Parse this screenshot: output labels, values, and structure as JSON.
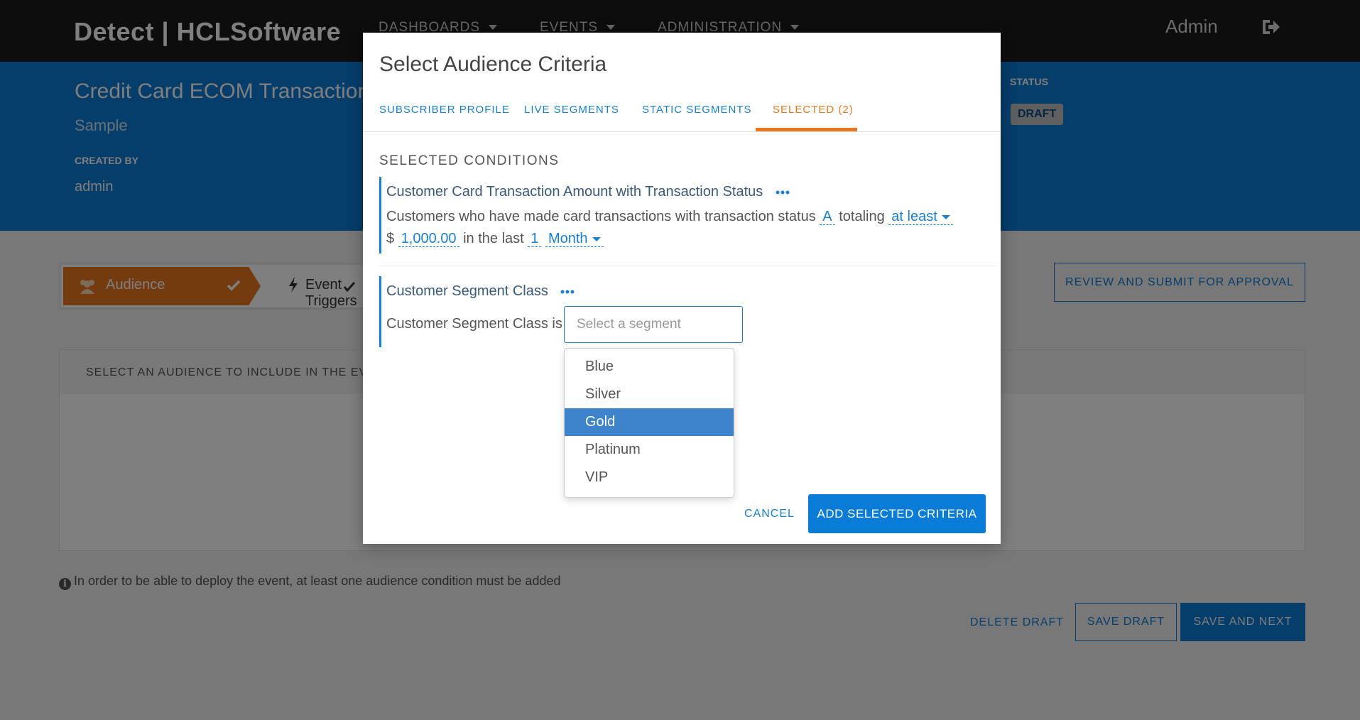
{
  "nav": {
    "logo": "Detect | HCLSoftware",
    "items": [
      "DASHBOARDS",
      "EVENTS",
      "ADMINISTRATION"
    ],
    "user": "Admin"
  },
  "header": {
    "title": "Credit Card ECOM Transaction",
    "subtitle": "Sample",
    "created_by_label": "CREATED BY",
    "created_by": "admin",
    "status_label": "STATUS",
    "status": "DRAFT"
  },
  "steps": {
    "audience": "Audience",
    "event_triggers": "Event Triggers"
  },
  "actions": {
    "review": "REVIEW AND SUBMIT FOR APPROVAL",
    "delete_draft": "DELETE DRAFT",
    "save_draft": "SAVE DRAFT",
    "save_next": "SAVE AND NEXT"
  },
  "panel": {
    "heading": "SELECT AN AUDIENCE TO INCLUDE IN THE EVE"
  },
  "info": "In order to be able to deploy the event, at least one audience condition must be added",
  "modal": {
    "title": "Select Audience Criteria",
    "tabs": [
      "SUBSCRIBER PROFILE",
      "LIVE SEGMENTS",
      "STATIC SEGMENTS",
      "SELECTED (2)"
    ],
    "active_tab": "SELECTED (2)",
    "selected_heading": "SELECTED CONDITIONS",
    "condition1": {
      "title": "Customer Card Transaction Amount with Transaction Status",
      "text_a": "Customers who have made card transactions with transaction status",
      "status_value": "A",
      "text_b": "totaling",
      "comparator": "at least",
      "currency": "$",
      "amount": "1,000.00",
      "text_c": "in the last",
      "period_count": "1",
      "period_unit": "Month"
    },
    "condition2": {
      "title": "Customer Segment Class",
      "text": "Customer Segment Class is",
      "placeholder": "Select a segment",
      "options": [
        "Blue",
        "Silver",
        "Gold",
        "Platinum",
        "VIP"
      ],
      "highlighted": "Gold"
    },
    "cancel": "CANCEL",
    "add": "ADD SELECTED CRITERIA"
  },
  "colors": {
    "brand_blue": "#0a7bd6",
    "accent_orange": "#e87722",
    "topbar": "#1a1a1a"
  }
}
